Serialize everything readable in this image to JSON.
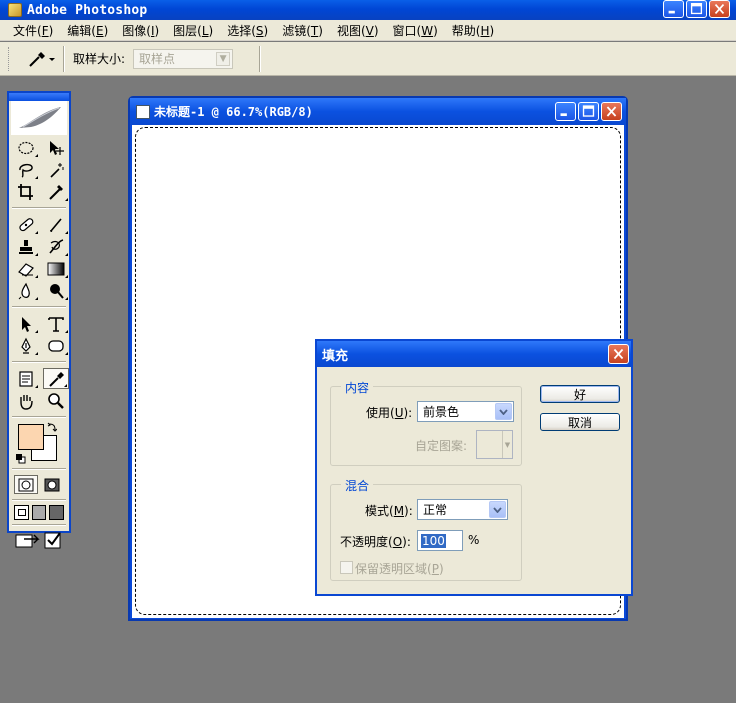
{
  "app": {
    "title": "Adobe Photoshop"
  },
  "menu": [
    {
      "label": "文件(",
      "key": "F",
      "suffix": ")"
    },
    {
      "label": "编辑(",
      "key": "E",
      "suffix": ")"
    },
    {
      "label": "图像(",
      "key": "I",
      "suffix": ")"
    },
    {
      "label": "图层(",
      "key": "L",
      "suffix": ")"
    },
    {
      "label": "选择(",
      "key": "S",
      "suffix": ")"
    },
    {
      "label": "滤镜(",
      "key": "T",
      "suffix": ")"
    },
    {
      "label": "视图(",
      "key": "V",
      "suffix": ")"
    },
    {
      "label": "窗口(",
      "key": "W",
      "suffix": ")"
    },
    {
      "label": "帮助(",
      "key": "H",
      "suffix": ")"
    }
  ],
  "options": {
    "sample_size_label": "取样大小:",
    "sample_size_value": "取样点"
  },
  "document": {
    "title": "未标题-1 @ 66.7%(RGB/8)"
  },
  "colors": {
    "foreground": "#fcd6b0",
    "background": "#ffffff",
    "xp_blue": "#0a49d8"
  },
  "fill_dialog": {
    "title": "填充",
    "content_group": "内容",
    "use_label": "使用(",
    "use_key": "U",
    "use_suffix": "):",
    "use_value": "前景色",
    "custom_pattern_label": "自定图案:",
    "blend_group": "混合",
    "mode_label": "模式(",
    "mode_key": "M",
    "mode_suffix": "):",
    "mode_value": "正常",
    "opacity_label": "不透明度(",
    "opacity_key": "O",
    "opacity_suffix": "):",
    "opacity_value": "100",
    "opacity_unit": "%",
    "preserve_label": "保留透明区域(",
    "preserve_key": "P",
    "preserve_suffix": ")",
    "ok_button": "好",
    "cancel_button": "取消"
  },
  "toolbox": {
    "tools": [
      "marquee-icon",
      "move-icon",
      "lasso-icon",
      "magic-wand-icon",
      "crop-icon",
      "slice-icon",
      "healing-brush-icon",
      "brush-icon",
      "clone-stamp-icon",
      "history-brush-icon",
      "eraser-icon",
      "gradient-icon",
      "blur-icon",
      "dodge-icon",
      "path-selection-icon",
      "type-icon",
      "pen-icon",
      "shape-icon",
      "notes-icon",
      "eyedropper-icon",
      "hand-icon",
      "zoom-icon"
    ]
  }
}
